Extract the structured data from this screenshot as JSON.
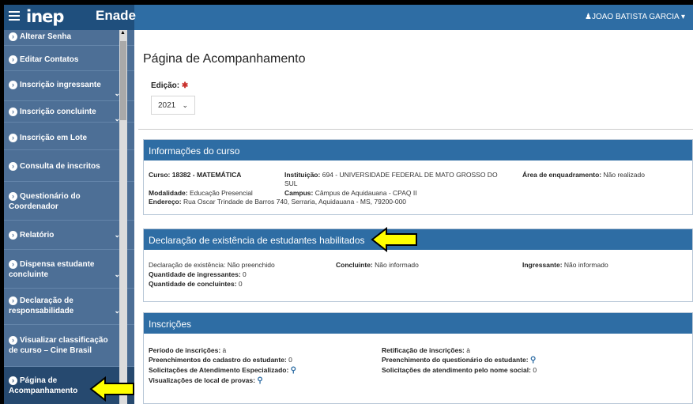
{
  "header": {
    "logo": "inep",
    "app_name": "Enade",
    "user": "JOAO BATISTA GARCIA"
  },
  "sidebar": {
    "items": [
      {
        "label": "Alterar Senha"
      },
      {
        "label": "Editar Contatos"
      },
      {
        "label": "Inscrição ingressante"
      },
      {
        "label": "Inscrição concluinte"
      },
      {
        "label": "Inscrição em Lote"
      },
      {
        "label": "Consulta de inscritos"
      },
      {
        "label_1": "Questionário do",
        "label_2": "Coordenador"
      },
      {
        "label": "Relatório"
      },
      {
        "label_1": "Dispensa estudante",
        "label_2": "concluinte"
      },
      {
        "label_1": "Declaração de",
        "label_2": "responsabilidade"
      },
      {
        "label_1": "Visualizar classificação",
        "label_2": "de curso – Cine Brasil"
      },
      {
        "label_1": "Página de",
        "label_2": "Acompanhamento"
      }
    ]
  },
  "main": {
    "title": "Página de Acompanhamento",
    "edition_label": "Edição:",
    "edition_required": "✱",
    "edition_value": "2021",
    "course_info": {
      "heading": "Informações do curso",
      "curso_label": "Curso: 18382 - MATEMÁTICA",
      "instituicao_label": "Instituição:",
      "instituicao_value_1": "694 -  UNIVERSIDADE FEDERAL DE MATO GROSSO DO",
      "instituicao_value_2": "SUL",
      "area_label": "Área de enquadramento:",
      "area_value": "Não realizado",
      "modalidade_label": "Modalidade:",
      "modalidade_value": "Educação Presencial",
      "campus_label": "Campus:",
      "campus_value": "Câmpus de Aquidauana - CPAQ II",
      "endereco_label": "Endereço:",
      "endereco_value": "Rua Oscar Trindade de Barros 740, Serraria, Aquidauana - MS, 79200-000"
    },
    "declaration": {
      "heading": "Declaração de existência de estudantes habilitados",
      "existencia_label": "Declaração de existência:",
      "existencia_value": "Não preenchido",
      "concluinte_label": "Concluinte:",
      "concluinte_value": "Não informado",
      "ingressante_label": "Ingressante:",
      "ingressante_value": "Não informado",
      "qtd_ingressantes_label": "Quantidade de ingressantes:",
      "qtd_ingressantes_value": "0",
      "qtd_concluintes_label": "Quantidade de concluintes:",
      "qtd_concluintes_value": "0"
    },
    "inscricoes": {
      "heading": "Inscrições",
      "periodo_label": "Período de inscrições:",
      "periodo_value": "à",
      "retificacao_label": "Retificação de inscrições:",
      "retificacao_value": "à",
      "cadastro_label": "Preenchimentos do cadastro do estudante:",
      "cadastro_value": "0",
      "questionario_label": "Preenchimento do questionário do estudante:",
      "atendimento_label": "Solicitações de Atendimento Especializado:",
      "nome_social_label": "Solicitações de atendimento pelo nome social:",
      "nome_social_value": "0",
      "local_label": "Visualizações de local de provas:"
    }
  },
  "colors": {
    "header_blue": "#2e6da4",
    "sidebar_blue": "#4d6f96",
    "arrow_yellow": "#ffff00"
  }
}
